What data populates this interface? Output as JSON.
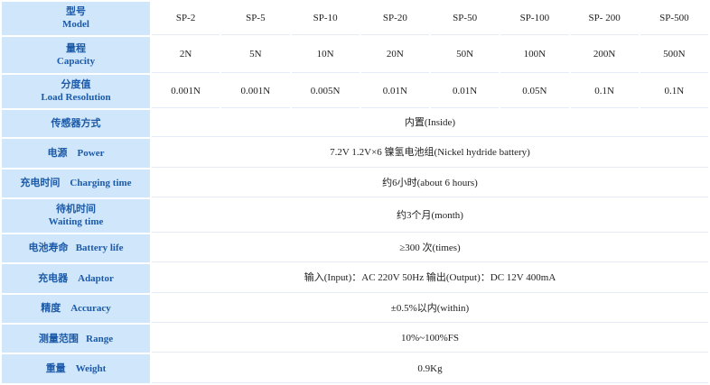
{
  "header": {
    "label_zh": "型号",
    "label_en": "Model",
    "models": [
      "SP-2",
      "SP-5",
      "SP-10",
      "SP-20",
      "SP-50",
      "SP-100",
      "SP- 200",
      "SP-500"
    ]
  },
  "capacity": {
    "label_zh": "量程",
    "label_en": "Capacity",
    "values": [
      "2N",
      "5N",
      "10N",
      "20N",
      "50N",
      "100N",
      "200N",
      "500N"
    ]
  },
  "resolution": {
    "label_zh": "分度值",
    "label_en": "Load Resolution",
    "values": [
      "0.001N",
      "0.001N",
      "0.005N",
      "0.01N",
      "0.01N",
      "0.05N",
      "0.1N",
      "0.1N"
    ]
  },
  "rows": [
    {
      "label_zh": "传感器方式",
      "label_en": "",
      "value": "内置(Inside)"
    },
    {
      "label_zh": "电源",
      "label_en": "Power",
      "value": "7.2V  1.2V×6 镍氢电池组(Nickel hydride battery)"
    },
    {
      "label_zh": "充电时间",
      "label_en": "Charging time",
      "value": "约6小时(about 6 hours)"
    },
    {
      "label_zh": "待机时间",
      "label_en": "Waiting time",
      "value": "约3个月(month)"
    },
    {
      "label_zh": "电池寿命",
      "label_en": "Battery life",
      "value": "≥300 次(times)"
    },
    {
      "label_zh": "充电器",
      "label_en": "Adaptor",
      "value": "输入(Input)：AC  220V  50Hz    输出(Output)：DC  12V  400mA"
    },
    {
      "label_zh": "精度",
      "label_en": "Accuracy",
      "value": "±0.5%以内(within)"
    },
    {
      "label_zh": "测量范围",
      "label_en": "Range",
      "value": "10%~100%FS"
    },
    {
      "label_zh": "重量",
      "label_en": "Weight",
      "value": "0.9Kg"
    }
  ]
}
